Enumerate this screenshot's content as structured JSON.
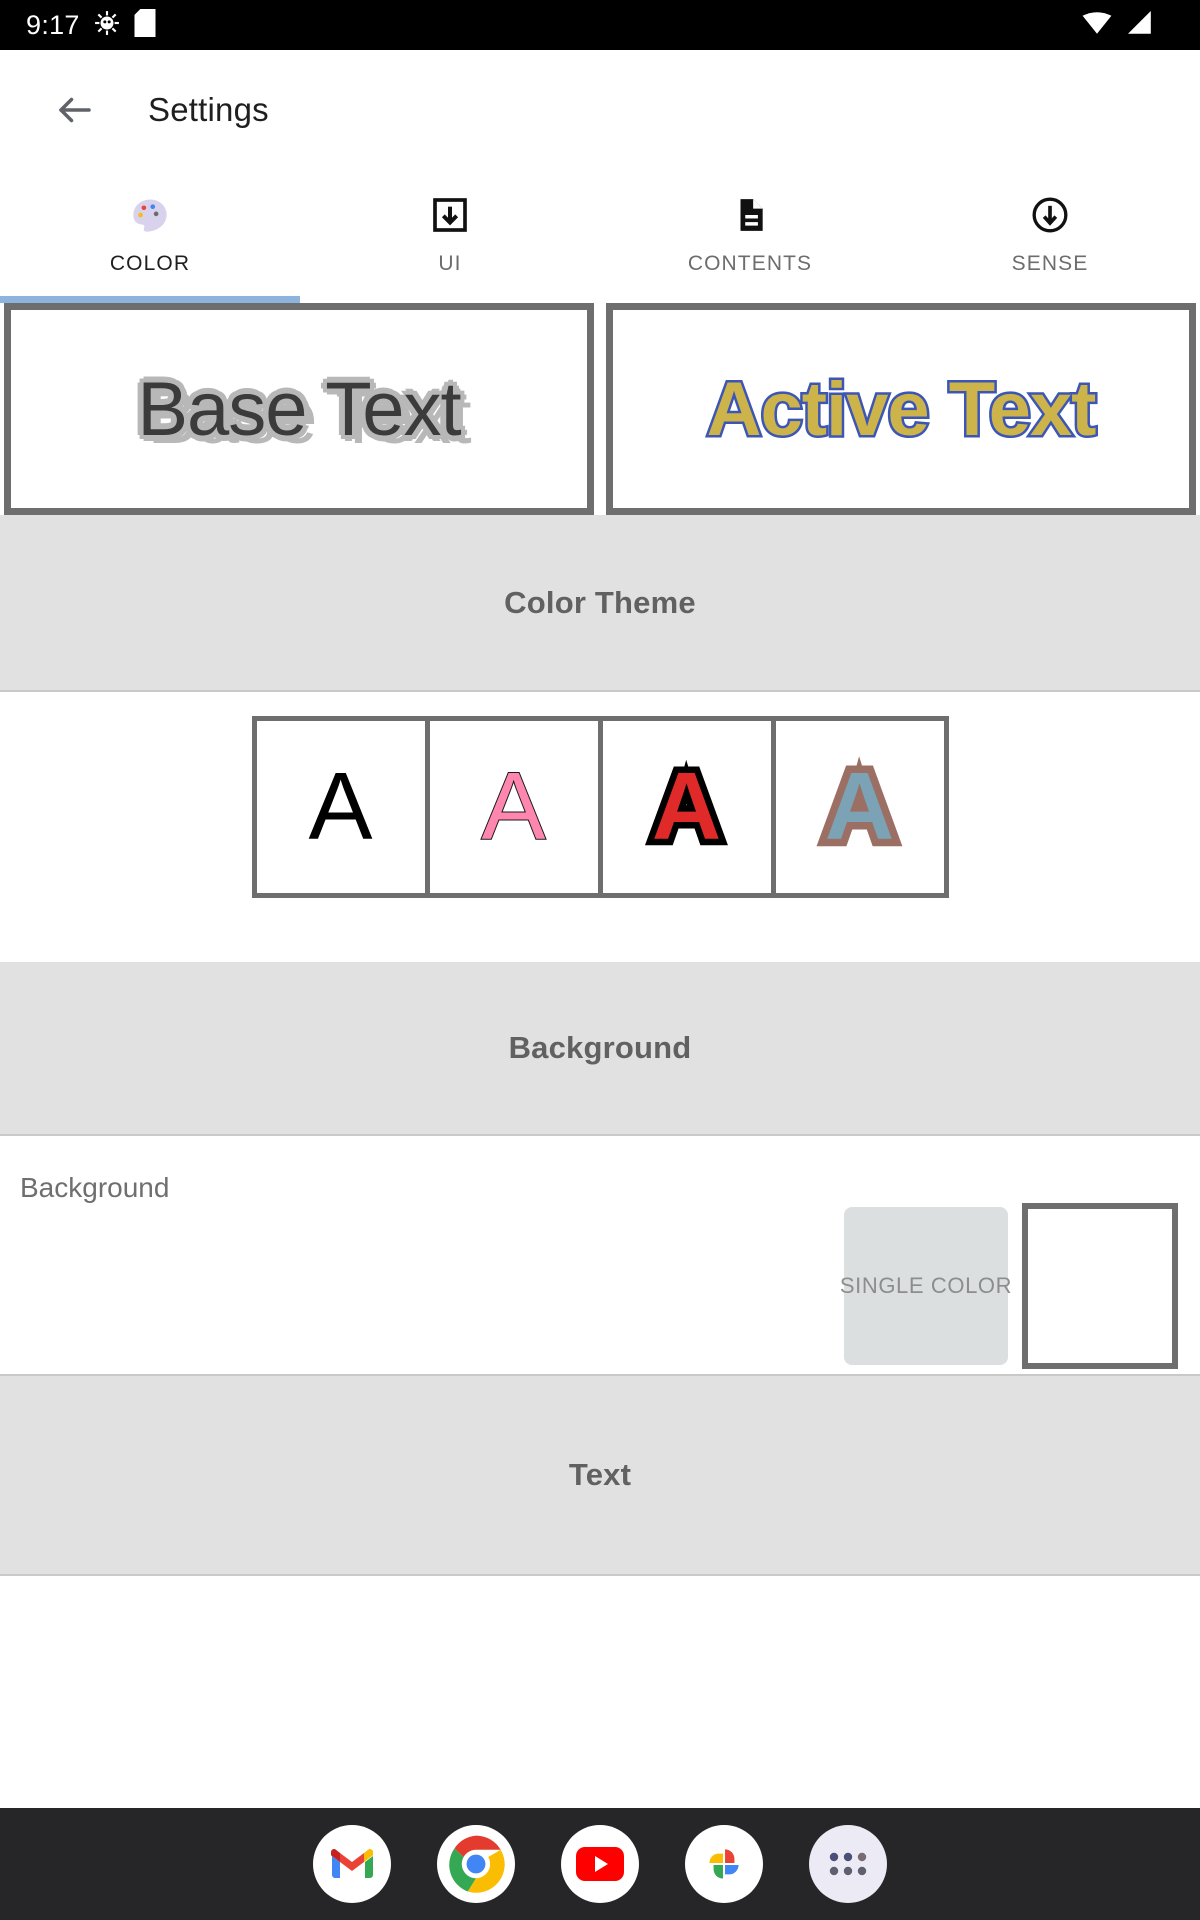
{
  "statusbar": {
    "time": "9:17",
    "left_icons": [
      "bug-icon",
      "sd-card-icon"
    ],
    "right_icons": [
      "wifi-icon",
      "signal-icon"
    ],
    "background": "#000000"
  },
  "appbar": {
    "back_icon": "arrow-back-icon",
    "title": "Settings"
  },
  "tabs": {
    "active_index": 0,
    "indicator_color": "#8db4dd",
    "items": [
      {
        "label": "COLOR",
        "icon": "palette-icon",
        "active": true
      },
      {
        "label": "UI",
        "icon": "download-box-icon",
        "active": false
      },
      {
        "label": "CONTENTS",
        "icon": "document-icon",
        "active": false
      },
      {
        "label": "SENSE",
        "icon": "circle-arrow-down-icon",
        "active": false
      }
    ]
  },
  "preview": {
    "base": {
      "text": "Base Text",
      "fill": "#3b3b3b",
      "outline": "#b8b8b8"
    },
    "active": {
      "text": "Active Text",
      "fill": "#cdb44a",
      "outline": "#3c56b5"
    }
  },
  "sections": {
    "color_theme": {
      "header": "Color Theme",
      "swatches": [
        {
          "glyph": "A",
          "fill": "#000000",
          "outline": "none"
        },
        {
          "glyph": "A",
          "fill": "#ff86ae",
          "outline": "#1a1a1a"
        },
        {
          "glyph": "A",
          "fill": "#e02a2a",
          "outline": "#000000"
        },
        {
          "glyph": "A",
          "fill": "#7ba3b5",
          "outline": "#9b6f63"
        }
      ]
    },
    "background": {
      "header": "Background",
      "row_label": "Background",
      "mode_button": "SINGLE COLOR",
      "swatch_color": "#ffffff"
    },
    "text": {
      "header": "Text"
    }
  },
  "dock": {
    "items": [
      {
        "name": "gmail"
      },
      {
        "name": "chrome"
      },
      {
        "name": "youtube"
      },
      {
        "name": "google-photos"
      },
      {
        "name": "app-drawer"
      }
    ],
    "background": "#262629"
  }
}
